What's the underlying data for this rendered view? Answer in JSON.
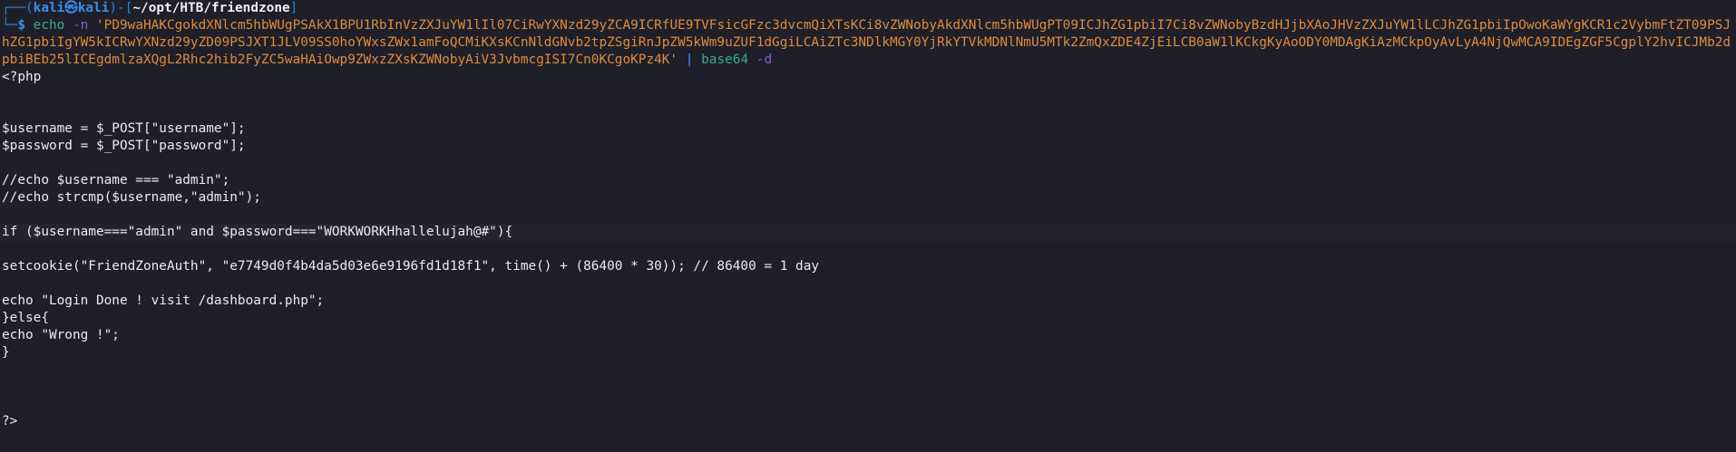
{
  "prompt": {
    "top_prefix": "┌──(",
    "user": "kali",
    "skull": "㉿",
    "host": "kali",
    "mid": ")-[",
    "path": "~/opt/HTB/friendzone",
    "close": "]",
    "bottom_prefix": "└─",
    "dollar": "$"
  },
  "command": {
    "name": "echo",
    "flag": "-n",
    "arg": "'PD9waHAKCgokdXNlcm5hbWUgPSAkX1BPU1RbInVzZXJuYW1lIl07CiRwYXNzd29yZCA9ICRfUE9TVFsicGFzc3dvcmQiXTsKCi8vZWNobyAkdXNlcm5hbWUgPT09ICJhZG1pbiI7Ci8vZWNobyBzdHJjbXAoJHVzZXJuYW1lLCJhZG1pbiIpOwoKaWYgKCR1c2VybmFtZT09PSJhZG1pbiIgYW5kICRwYXNzd29yZD09PSJXT1JLV09SS0hoYWxsZWx1amFoQCMiKXsKCnNldGNvb2tpZSgiRnJpZW5kWm9uZUF1dGgiLCAiZTc3NDlkMGY0YjRkYTVkMDNlNmU5MTk2ZmQxZDE4ZjEiLCB0aW1lKCkgKyAoODY0MDAgKiAzMCkpOyAvLyA4NjQwMCA9IDEgZGF5CgplY2hvICJMb2dpbiBEb25lICEgdmlzaXQgL2Rhc2hib2FyZC5waHAiOwp9ZWxzZXsKZWNobyAiV3JvbmcgISI7Cn0KCgoKPz4K'",
    "pipe": "|",
    "pipe_cmd": "base64",
    "pipe_flag": "-d"
  },
  "output_lines": [
    "<?php",
    "",
    "",
    "$username = $_POST[\"username\"];",
    "$password = $_POST[\"password\"];",
    "",
    "//echo $username === \"admin\";",
    "//echo strcmp($username,\"admin\");",
    "",
    "if ($username===\"admin\" and $password===\"WORKWORKHhallelujah@#\"){",
    "",
    "setcookie(\"FriendZoneAuth\", \"e7749d0f4b4da5d03e6e9196fd1d18f1\", time() + (86400 * 30)); // 86400 = 1 day",
    "",
    "echo \"Login Done ! visit /dashboard.php\";",
    "}else{",
    "echo \"Wrong !\";",
    "}",
    "",
    "",
    "",
    "?>"
  ]
}
